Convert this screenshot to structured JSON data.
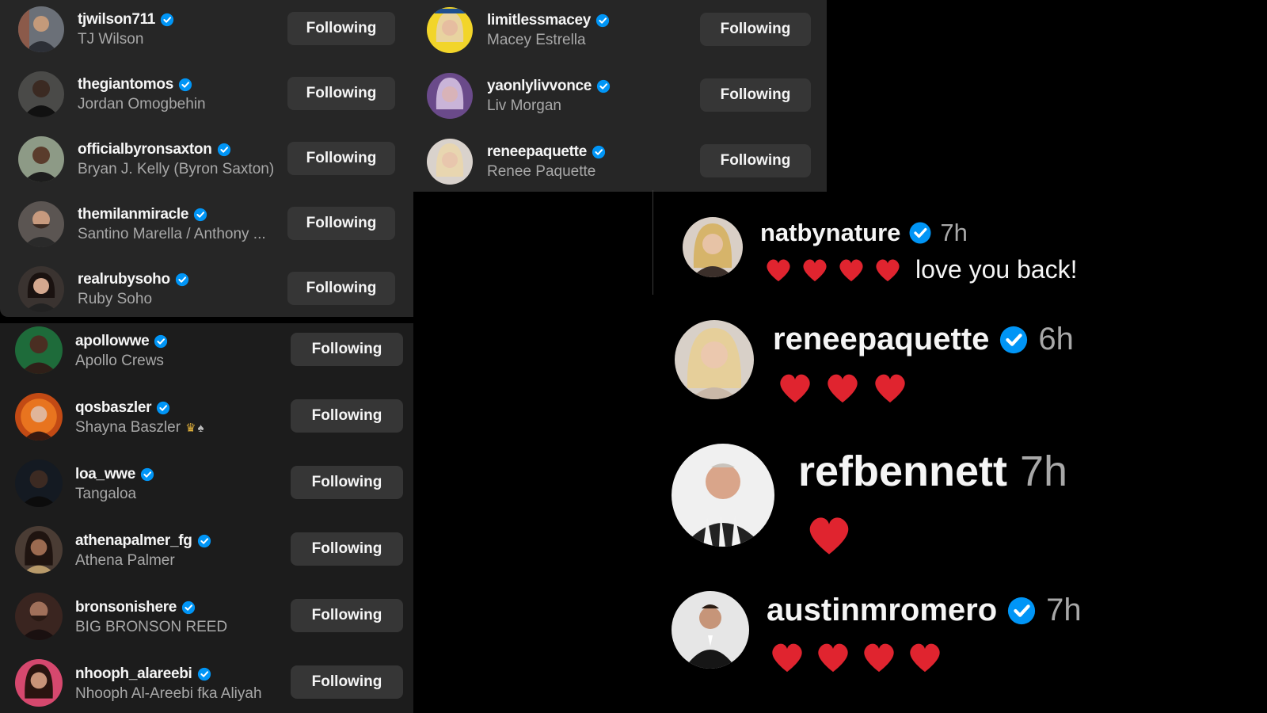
{
  "panel_left_top": {
    "items": [
      {
        "username": "tjwilson711",
        "name": "TJ Wilson",
        "button": "Following"
      },
      {
        "username": "thegiantomos",
        "name": "Jordan Omogbehin",
        "button": "Following"
      },
      {
        "username": "officialbyronsaxton",
        "name": "Bryan J. Kelly (Byron Saxton)",
        "button": "Following"
      },
      {
        "username": "themilanmiracle",
        "name": "Santino Marella / Anthony ...",
        "button": "Following"
      },
      {
        "username": "realrubysoho",
        "name": "Ruby Soho",
        "button": "Following"
      }
    ]
  },
  "panel_right_top": {
    "items": [
      {
        "username": "limitlessmacey",
        "name": "Macey Estrella",
        "button": "Following"
      },
      {
        "username": "yaonlylivvonce",
        "name": "Liv Morgan",
        "button": "Following"
      },
      {
        "username": "reneepaquette",
        "name": "Renee Paquette",
        "button": "Following"
      }
    ]
  },
  "panel_left_bottom": {
    "items": [
      {
        "username": "apollowwe",
        "name": "Apollo Crews",
        "button": "Following"
      },
      {
        "username": "qosbaszler",
        "name": "Shayna Baszler",
        "button": "Following",
        "extra_icons": [
          "crown-icon",
          "spade-icon"
        ]
      },
      {
        "username": "loa_wwe",
        "name": "Tangaloa",
        "button": "Following"
      },
      {
        "username": "athenapalmer_fg",
        "name": "Athena Palmer",
        "button": "Following"
      },
      {
        "username": "bronsonishere",
        "name": "BIG BRONSON REED",
        "button": "Following"
      },
      {
        "username": "nhooph_alareebi",
        "name": "Nhooph Al-Areebi fka Aliyah",
        "button": "Following"
      }
    ]
  },
  "comments": [
    {
      "username": "natbynature",
      "time": "7h",
      "verified": true,
      "hearts": 4,
      "text": "love you back!"
    },
    {
      "username": "reneepaquette",
      "time": "6h",
      "verified": true,
      "hearts": 3,
      "text": ""
    },
    {
      "username": "refbennett",
      "time": "7h",
      "verified": false,
      "hearts": 1,
      "text": ""
    },
    {
      "username": "austinmromero",
      "time": "7h",
      "verified": true,
      "hearts": 4,
      "text": ""
    }
  ],
  "colors": {
    "background": "#000000",
    "panel": "#262626",
    "button": "#363636",
    "verified_badge": "#0095f6",
    "heart": "#e0242f",
    "secondary_text": "#a8a8a8"
  }
}
